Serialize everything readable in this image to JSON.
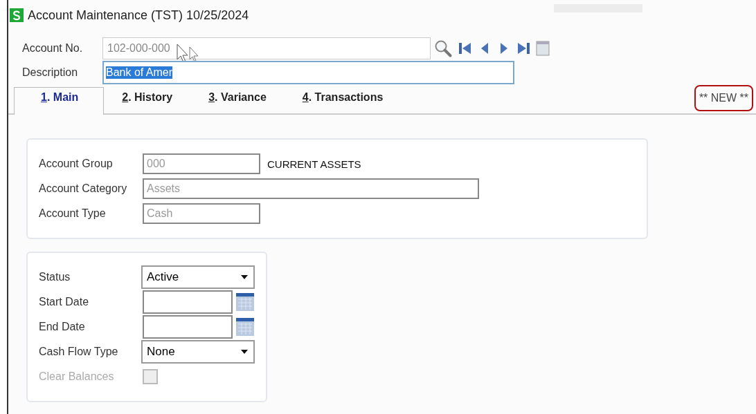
{
  "window": {
    "title": "Account Maintenance (TST) 10/25/2024"
  },
  "header": {
    "account_no": {
      "label": "Account No.",
      "value": "102-000-000"
    },
    "description": {
      "label": "Description",
      "value": "Bank of Amer",
      "selected": true
    }
  },
  "tabs": [
    {
      "label": "1. Main",
      "selected": true
    },
    {
      "label": "2. History",
      "selected": false
    },
    {
      "label": "3. Variance",
      "selected": false
    },
    {
      "label": "4. Transactions",
      "selected": false
    }
  ],
  "record_status": "** NEW **",
  "account_section": [
    {
      "label": "Account Group",
      "value": "000",
      "wide": false,
      "note": "CURRENT ASSETS"
    },
    {
      "label": "Account Category",
      "value": "Assets",
      "wide": true
    },
    {
      "label": "Account Type",
      "value": "Cash",
      "wide": false
    }
  ],
  "settings_section": [
    {
      "kind": "dropdown",
      "label": "Status",
      "value": "Active",
      "disabled": false
    },
    {
      "kind": "date",
      "label": "Start Date",
      "disabled": false
    },
    {
      "kind": "date",
      "label": "End Date",
      "disabled": false
    },
    {
      "kind": "dropdown",
      "label": "Cash Flow Type",
      "value": "None",
      "disabled": false
    },
    {
      "kind": "checkbox",
      "label": "Clear Balances",
      "checked": false,
      "disabled": true
    }
  ]
}
